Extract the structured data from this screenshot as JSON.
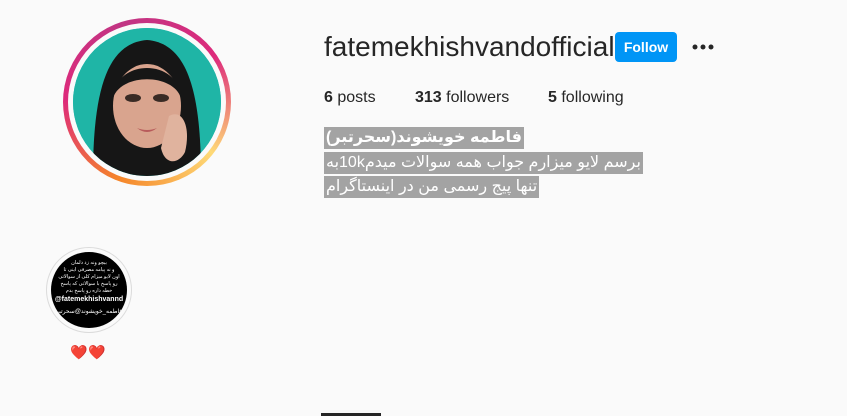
{
  "profile": {
    "username": "fatemekhishvandofficial",
    "follow_label": "Follow",
    "more_label": "•••",
    "stats": {
      "posts_count": "6",
      "posts_label": "posts",
      "followers_count": "313",
      "followers_label": "followers",
      "following_count": "5",
      "following_label": "following"
    },
    "bio": {
      "name": "فاطمه خویشوند(سحرتبر)",
      "line1": "برسم لایو میزارم جواب همه سوالات میدم10kبه",
      "line2": "تنها پیج رسمی من در اینستاگرام"
    }
  },
  "highlight": {
    "text_lines": [
      "بیچو ونه زد دلمان",
      "و نه پیامه مصرفی اینی تا",
      "اون لایو میزام کلی از سوالاتی",
      "رو پاسخ با سوالاتی که پاسخ",
      "خطه داره رو پاسخ بدم"
    ],
    "handle": "@fatemekhishvannd",
    "sub": "فاطمه_خویشوند@سحرتبر",
    "label": "❤️❤️"
  },
  "colors": {
    "follow_button": "#0095f6",
    "bio_highlight": "#a3a3a3"
  }
}
